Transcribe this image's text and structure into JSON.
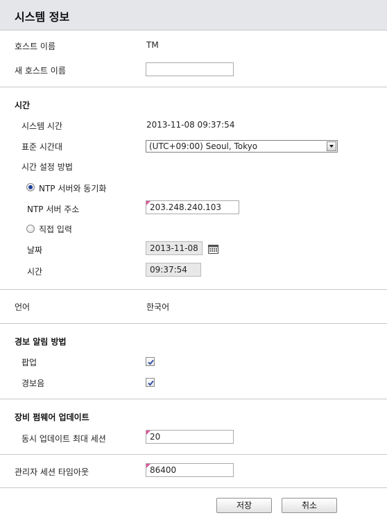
{
  "header": {
    "title": "시스템 정보"
  },
  "host": {
    "name_label": "호스트 이름",
    "name_value": "TM",
    "new_name_label": "새 호스트 이름",
    "new_name_value": ""
  },
  "time": {
    "section_title": "시간",
    "system_time_label": "시스템 시간",
    "system_time_value": "2013-11-08 09:37:54",
    "timezone_label": "표준 시간대",
    "timezone_value": "(UTC+09:00) Seoul, Tokyo",
    "method_label": "시간 설정 방법",
    "ntp_radio_label": "NTP 서버와 동기화",
    "ntp_radio_selected": true,
    "ntp_address_label": "NTP 서버 주소",
    "ntp_address_value": "203.248.240.103",
    "manual_radio_label": "직접 입력",
    "manual_radio_selected": false,
    "date_label": "날짜",
    "date_value": "2013-11-08",
    "time_label": "시간",
    "time_value": "09:37:54"
  },
  "language": {
    "label": "언어",
    "value": "한국어"
  },
  "alert": {
    "section_title": "경보 알림 방법",
    "popup_label": "팝업",
    "popup_checked": true,
    "sound_label": "경보음",
    "sound_checked": true
  },
  "firmware": {
    "section_title": "장비 펌웨어 업데이트",
    "max_sessions_label": "동시 업데이트 최대 세션",
    "max_sessions_value": "20"
  },
  "admin": {
    "timeout_label": "관리자 세션 타임아웃",
    "timeout_value": "86400"
  },
  "buttons": {
    "save_label": "저장",
    "cancel_label": "취소"
  },
  "icons": {
    "calendar": "calendar-icon",
    "check": "check-icon",
    "dropdown": "chevron-down-icon"
  },
  "colors": {
    "header_bg": "#e4e6e9",
    "required_marker": "#e0559a",
    "radio_dot": "#1f3f9a",
    "check_mark": "#2b4aa0"
  }
}
